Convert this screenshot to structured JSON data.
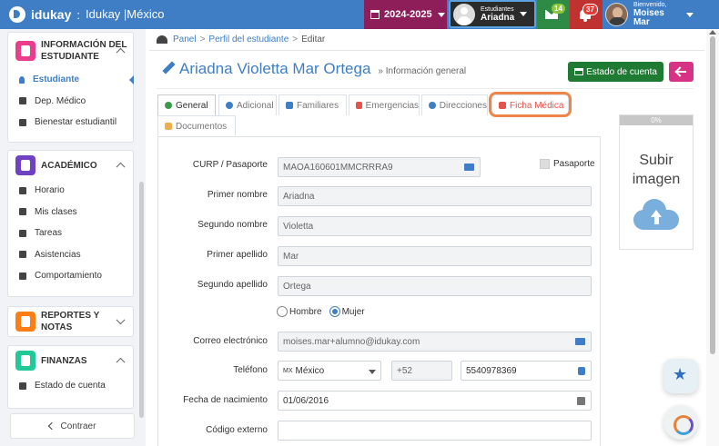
{
  "brand": {
    "name": "idukay",
    "separator": ":",
    "school": "Idukay |México"
  },
  "topbar": {
    "year": "2024-2025",
    "student_caption": "Estudiantes",
    "student_name": "Ariadna",
    "messages_count": "14",
    "notifications_count": "37",
    "welcome_caption": "Bienvenido,",
    "user_name": "Moises Mar"
  },
  "sidebar": {
    "sections": [
      {
        "title": "INFORMACIÓN DEL ESTUDIANTE",
        "color": "#e83e8c",
        "items": [
          "Estudiante",
          "Dep. Médico",
          "Bienestar estudiantil"
        ]
      },
      {
        "title": "ACADÉMICO",
        "color": "#6f42c1",
        "items": [
          "Horario",
          "Mis clases",
          "Tareas",
          "Asistencias",
          "Comportamiento"
        ]
      },
      {
        "title": "REPORTES Y NOTAS",
        "color": "#fd7e14",
        "items": []
      },
      {
        "title": "FINANZAS",
        "color": "#20c997",
        "items": [
          "Estado de cuenta"
        ]
      }
    ],
    "collapse_label": "Contraer"
  },
  "breadcrumb": {
    "panel": "Panel",
    "profile": "Perfil del estudiante",
    "current": "Editar",
    "sep": ">"
  },
  "page": {
    "title": "Ariadna Violetta Mar Ortega",
    "subtitle": "» Información general",
    "account_button": "Estado de cuenta"
  },
  "tabs": [
    "General",
    "Adicional",
    "Familiares",
    "Emergencias",
    "Direcciones",
    "Ficha Médica",
    "Documentos"
  ],
  "form": {
    "curp_label": "CURP / Pasaporte",
    "curp_value": "MAOA160601MMCRRRA9",
    "passport_label": "Pasaporte",
    "first_name_label": "Primer nombre",
    "first_name_value": "Ariadna",
    "second_name_label": "Segundo nombre",
    "second_name_value": "Violetta",
    "first_surname_label": "Primer apellido",
    "first_surname_value": "Mar",
    "second_surname_label": "Segundo apellido",
    "second_surname_value": "Ortega",
    "gender_male": "Hombre",
    "gender_female": "Mujer",
    "email_label": "Correo electrónico",
    "email_value": "moises.mar+alumno@idukay.com",
    "phone_label": "Teléfono",
    "phone_country_code": "MX",
    "phone_country": "México",
    "phone_prefix": "+52",
    "phone_number": "5540978369",
    "birth_label": "Fecha de nacimiento",
    "birth_value": "01/06/2016",
    "external_code_label": "Código externo",
    "external_code_value": ""
  },
  "upload": {
    "progress": "0%",
    "line1": "Subir",
    "line2": "imagen"
  }
}
